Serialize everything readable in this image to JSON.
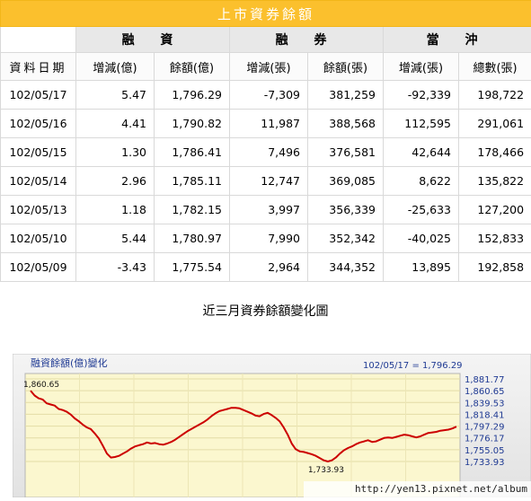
{
  "table": {
    "title": "上市資券餘額",
    "groups": [
      "融 資",
      "融 券",
      "當 沖"
    ],
    "headers": [
      "資料日期",
      "增減(億)",
      "餘額(億)",
      "增減(張)",
      "餘額(張)",
      "增減(張)",
      "總數(張)"
    ],
    "rows": [
      [
        "102/05/17",
        "5.47",
        "1,796.29",
        "-7,309",
        "381,259",
        "-92,339",
        "198,722"
      ],
      [
        "102/05/16",
        "4.41",
        "1,790.82",
        "11,987",
        "388,568",
        "112,595",
        "291,061"
      ],
      [
        "102/05/15",
        "1.30",
        "1,786.41",
        "7,496",
        "376,581",
        "42,644",
        "178,466"
      ],
      [
        "102/05/14",
        "2.96",
        "1,785.11",
        "12,747",
        "369,085",
        "8,622",
        "135,822"
      ],
      [
        "102/05/13",
        "1.18",
        "1,782.15",
        "3,997",
        "356,339",
        "-25,633",
        "127,200"
      ],
      [
        "102/05/10",
        "5.44",
        "1,780.97",
        "7,990",
        "352,342",
        "-40,025",
        "152,833"
      ],
      [
        "102/05/09",
        "-3.43",
        "1,775.54",
        "2,964",
        "344,352",
        "13,895",
        "192,858"
      ]
    ]
  },
  "caption": "近三月資券餘額變化圖",
  "watermark": "http://yen13.pixnet.net/album",
  "colors": {
    "title_bg": "#fbc02d",
    "plot_bg": "#fbf7cf",
    "line": "#cc0000",
    "axis_text": "#1f3a93"
  },
  "chart_data": {
    "type": "line",
    "title": "融資餘額(億)變化",
    "status": "102/05/17 = 1,796.29",
    "y_ticks": [
      "1,881.77",
      "1,860.65",
      "1,839.53",
      "1,818.41",
      "1,797.29",
      "1,776.17",
      "1,755.05",
      "1,733.93"
    ],
    "ylim": [
      1733.93,
      1881.77
    ],
    "annotations": {
      "max_label": "1,860.65",
      "min_label": "1,733.93"
    },
    "series": [
      {
        "values": [
          1860.65,
          1852,
          1847,
          1845,
          1838,
          1836,
          1834,
          1828,
          1826,
          1823,
          1818,
          1811,
          1806,
          1800,
          1795,
          1792,
          1784,
          1775,
          1762,
          1748,
          1741,
          1742,
          1744,
          1748,
          1752,
          1757,
          1761,
          1763,
          1765,
          1768,
          1766,
          1767,
          1765,
          1764,
          1766,
          1769,
          1773,
          1778,
          1783,
          1788,
          1792,
          1796,
          1800,
          1804,
          1809,
          1815,
          1820,
          1824,
          1826,
          1828,
          1830,
          1830,
          1829,
          1826,
          1823,
          1820,
          1816,
          1815,
          1819,
          1821,
          1817,
          1812,
          1806,
          1795,
          1782,
          1766,
          1756,
          1752,
          1751,
          1749,
          1747,
          1744,
          1740,
          1736,
          1733.93,
          1736,
          1741,
          1748,
          1754,
          1758,
          1761,
          1765,
          1768,
          1770,
          1772,
          1769,
          1770,
          1773,
          1776,
          1777,
          1776,
          1778,
          1780,
          1782,
          1781,
          1779,
          1777,
          1779,
          1782,
          1785,
          1786,
          1787,
          1789,
          1790,
          1791,
          1793,
          1796.29
        ]
      }
    ]
  }
}
